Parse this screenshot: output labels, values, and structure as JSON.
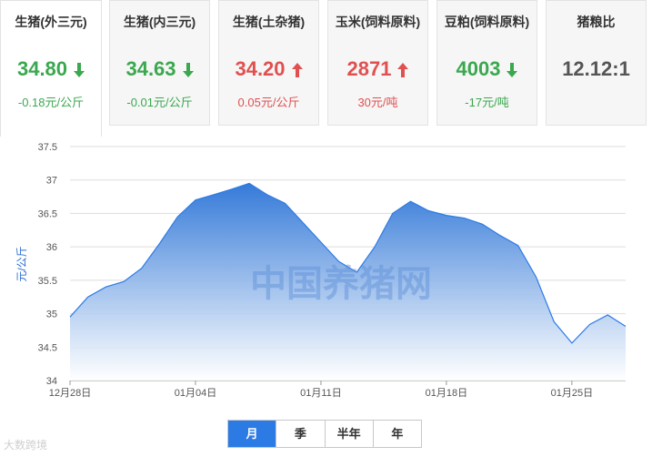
{
  "cards": [
    {
      "name": "生猪(外三元)",
      "price": "34.80",
      "arrow": "down",
      "change": "-0.18元/公斤",
      "state": "down"
    },
    {
      "name": "生猪(内三元)",
      "price": "34.63",
      "arrow": "down",
      "change": "-0.01元/公斤",
      "state": "down"
    },
    {
      "name": "生猪(土杂猪)",
      "price": "34.20",
      "arrow": "up",
      "change": "0.05元/公斤",
      "state": "up"
    },
    {
      "name": "玉米(饲料原料)",
      "price": "2871",
      "arrow": "up",
      "change": "30元/吨",
      "state": "up"
    },
    {
      "name": "豆粕(饲料原料)",
      "price": "4003",
      "arrow": "down",
      "change": "-17元/吨",
      "state": "down"
    },
    {
      "name": "猪粮比",
      "price": "12.12:1",
      "arrow": "",
      "change": "",
      "state": "neutral"
    }
  ],
  "colors": {
    "up": "#e05050",
    "down": "#3aa84e",
    "accent": "#2c7be5",
    "area_top": "#2a73d6",
    "area_bottom": "#ffffff"
  },
  "tabs": [
    {
      "label": "月",
      "active": true
    },
    {
      "label": "季",
      "active": false
    },
    {
      "label": "半年",
      "active": false
    },
    {
      "label": "年",
      "active": false
    }
  ],
  "watermark": "中国养猪网",
  "watermark2": "大数跨境",
  "chart_data": {
    "type": "area",
    "ylabel": "元/公斤",
    "ylim": [
      34,
      37.5
    ],
    "yticks": [
      34,
      34.5,
      35,
      35.5,
      36,
      36.5,
      37,
      37.5
    ],
    "grid": true,
    "x_tick_labels": [
      {
        "label": "12月28日",
        "index": 0
      },
      {
        "label": "01月04日",
        "index": 7
      },
      {
        "label": "01月11日",
        "index": 14
      },
      {
        "label": "01月18日",
        "index": 21
      },
      {
        "label": "01月25日",
        "index": 28
      }
    ],
    "values": [
      34.95,
      35.25,
      35.4,
      35.48,
      35.68,
      36.05,
      36.45,
      36.7,
      36.78,
      36.86,
      36.95,
      36.78,
      36.65,
      36.36,
      36.07,
      35.78,
      35.62,
      36.0,
      36.5,
      36.68,
      36.54,
      36.47,
      36.43,
      36.34,
      36.17,
      36.02,
      35.55,
      34.88,
      34.56,
      34.84,
      34.98,
      34.81
    ]
  }
}
